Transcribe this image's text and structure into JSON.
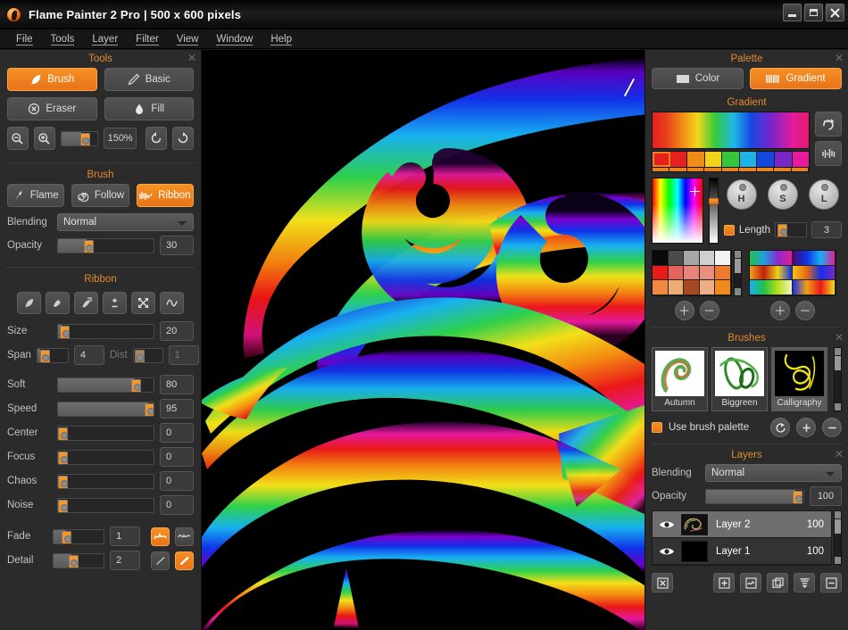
{
  "window": {
    "title": "Flame Painter 2 Pro  |  500 x 600 pixels",
    "minimize": "–",
    "maximize": "□",
    "close": "✕"
  },
  "menu": [
    "File",
    "Tools",
    "Layer",
    "Filter",
    "View",
    "Window",
    "Help"
  ],
  "tools_panel": {
    "title": "Tools",
    "close": "✕",
    "buttons": [
      {
        "label": "Brush",
        "icon": "feather-icon",
        "active": true
      },
      {
        "label": "Basic",
        "icon": "pencil-icon",
        "active": false
      },
      {
        "label": "Eraser",
        "icon": "eraser-icon",
        "active": false
      },
      {
        "label": "Fill",
        "icon": "droplet-icon",
        "active": false
      }
    ],
    "zoom": {
      "out_icon": "zoom-out-icon",
      "in_icon": "zoom-in-icon",
      "value": "150%",
      "slider_pct": 60,
      "rotate_ccw_icon": "rotate-left-icon",
      "rotate_cw_icon": "rotate-right-icon"
    }
  },
  "brush_panel": {
    "title": "Brush",
    "modes": [
      {
        "label": "Flame",
        "icon": "flame-icon",
        "active": false
      },
      {
        "label": "Follow",
        "icon": "spiral-icon",
        "active": false
      },
      {
        "label": "Ribbon",
        "icon": "ribbon-icon",
        "active": true
      }
    ],
    "blending_label": "Blending",
    "blending_value": "Normal",
    "opacity_label": "Opacity",
    "opacity_value": "30",
    "opacity_pct": 30
  },
  "ribbon_panel": {
    "title": "Ribbon",
    "mode_icons": [
      "quill-icon",
      "pen-icon",
      "pen-arrow-icon",
      "plus-minus-icon",
      "expand-icon",
      "wave-icon"
    ],
    "sliders": [
      {
        "label": "Size",
        "value": "20",
        "pct": 6
      },
      {
        "label": "Soft",
        "value": "80",
        "pct": 80
      },
      {
        "label": "Speed",
        "value": "95",
        "pct": 93
      },
      {
        "label": "Center",
        "value": "0",
        "pct": 0
      },
      {
        "label": "Focus",
        "value": "0",
        "pct": 0
      },
      {
        "label": "Chaos",
        "value": "0",
        "pct": 0
      },
      {
        "label": "Noise",
        "value": "0",
        "pct": 0
      }
    ],
    "span": {
      "label": "Span",
      "value": "4",
      "pct": 10
    },
    "dist": {
      "label": "Dist",
      "value": "1",
      "pct": 20,
      "disabled": true
    },
    "fade": {
      "label": "Fade",
      "value": "1",
      "pct": 22
    },
    "detail": {
      "label": "Detail",
      "value": "2",
      "pct": 35
    },
    "fade_toggles": [
      {
        "icon": "wave-a-icon",
        "active": true
      },
      {
        "icon": "wave-b-icon",
        "active": false
      }
    ],
    "detail_toggles": [
      {
        "icon": "line-thin-icon",
        "active": false
      },
      {
        "icon": "line-thick-icon",
        "active": true
      }
    ]
  },
  "palette_panel": {
    "title": "Palette",
    "close": "✕",
    "tabs": [
      {
        "label": "Color",
        "icon": "color-swatch-icon",
        "active": false
      },
      {
        "label": "Gradient",
        "icon": "gradient-bars-icon",
        "active": true
      }
    ],
    "section_title": "Gradient",
    "swatches": [
      "#e5201f",
      "#e5201f",
      "#ef8b16",
      "#f0d319",
      "#36c63c",
      "#1fb2e6",
      "#1348dd",
      "#7826c8",
      "#e51b9c"
    ],
    "side_buttons": [
      {
        "icon": "loop-arrow-icon"
      },
      {
        "icon": "equalizer-icon"
      }
    ],
    "knobs": [
      "H",
      "S",
      "L"
    ],
    "length_label": "Length",
    "length_value": "3",
    "length_pct": 35,
    "mini_palette": [
      "#0a0a0a",
      "#4b4b4b",
      "#a6a6a6",
      "#d0d0d0",
      "#f2f2f2",
      "#e81a1a",
      "#e5635a",
      "#e9847a",
      "#e98f7f",
      "#ee7a2a",
      "#ef8840",
      "#eeab74",
      "#a8491f",
      "#eeae87",
      "#f08a1a"
    ],
    "add_color": "＋",
    "remove_color": "－",
    "add_gradient": "＋",
    "remove_gradient": "－"
  },
  "brushes_panel": {
    "title": "Brushes",
    "close": "✕",
    "items": [
      {
        "name": "Autumn",
        "selected": false
      },
      {
        "name": "Biggreen",
        "selected": false
      },
      {
        "name": "Calligraphy",
        "selected": true
      }
    ],
    "use_brush_palette_label": "Use brush palette",
    "use_brush_palette_checked": true,
    "actions": [
      {
        "icon": "export-icon"
      },
      {
        "icon": "plus-circle-icon"
      },
      {
        "icon": "minus-circle-icon"
      }
    ]
  },
  "layers_panel": {
    "title": "Layers",
    "close": "✕",
    "blending_label": "Blending",
    "blending_value": "Normal",
    "opacity_label": "Opacity",
    "opacity_value": "100",
    "opacity_pct": 90,
    "layers": [
      {
        "name": "Layer 2",
        "opacity": "100",
        "visible": true,
        "selected": true
      },
      {
        "name": "Layer 1",
        "opacity": "100",
        "visible": true,
        "selected": false
      }
    ],
    "buttons": [
      {
        "icon": "clear-layer-icon"
      },
      {
        "icon": "add-layer-icon"
      },
      {
        "icon": "effect-layer-icon"
      },
      {
        "icon": "duplicate-layer-icon"
      },
      {
        "icon": "merge-layer-icon"
      },
      {
        "icon": "delete-layer-icon"
      }
    ]
  },
  "canvas": {
    "name": "artwork-canvas",
    "background": "#000000",
    "cursor": "diagonal-line-cursor"
  }
}
